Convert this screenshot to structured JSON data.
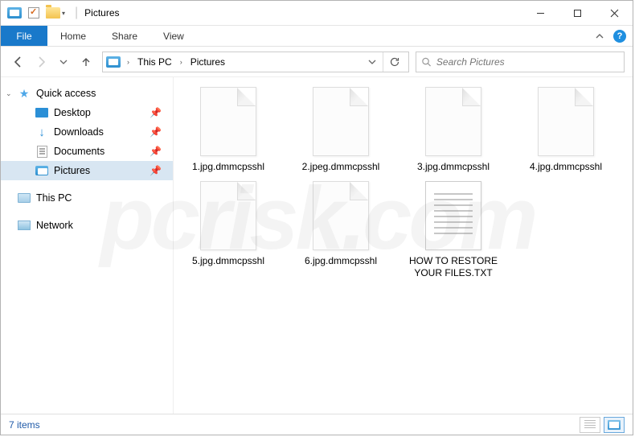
{
  "window": {
    "title": "Pictures"
  },
  "ribbon": {
    "file": "File",
    "tabs": [
      "Home",
      "Share",
      "View"
    ]
  },
  "breadcrumb": {
    "root": "This PC",
    "current": "Pictures"
  },
  "search": {
    "placeholder": "Search Pictures"
  },
  "sidebar": {
    "quick_access": "Quick access",
    "items": [
      {
        "label": "Desktop",
        "pinned": true
      },
      {
        "label": "Downloads",
        "pinned": true
      },
      {
        "label": "Documents",
        "pinned": true
      },
      {
        "label": "Pictures",
        "pinned": true,
        "selected": true
      }
    ],
    "this_pc": "This PC",
    "network": "Network"
  },
  "files": [
    {
      "name": "1.jpg.dmmcpsshl",
      "type": "generic"
    },
    {
      "name": "2.jpeg.dmmcpsshl",
      "type": "generic"
    },
    {
      "name": "3.jpg.dmmcpsshl",
      "type": "generic"
    },
    {
      "name": "4.jpg.dmmcpsshl",
      "type": "generic"
    },
    {
      "name": "5.jpg.dmmcpsshl",
      "type": "generic"
    },
    {
      "name": "6.jpg.dmmcpsshl",
      "type": "generic"
    },
    {
      "name": "HOW TO RESTORE YOUR FILES.TXT",
      "type": "txt"
    }
  ],
  "status": {
    "text": "7 items"
  },
  "watermark": "pcrisk.com"
}
